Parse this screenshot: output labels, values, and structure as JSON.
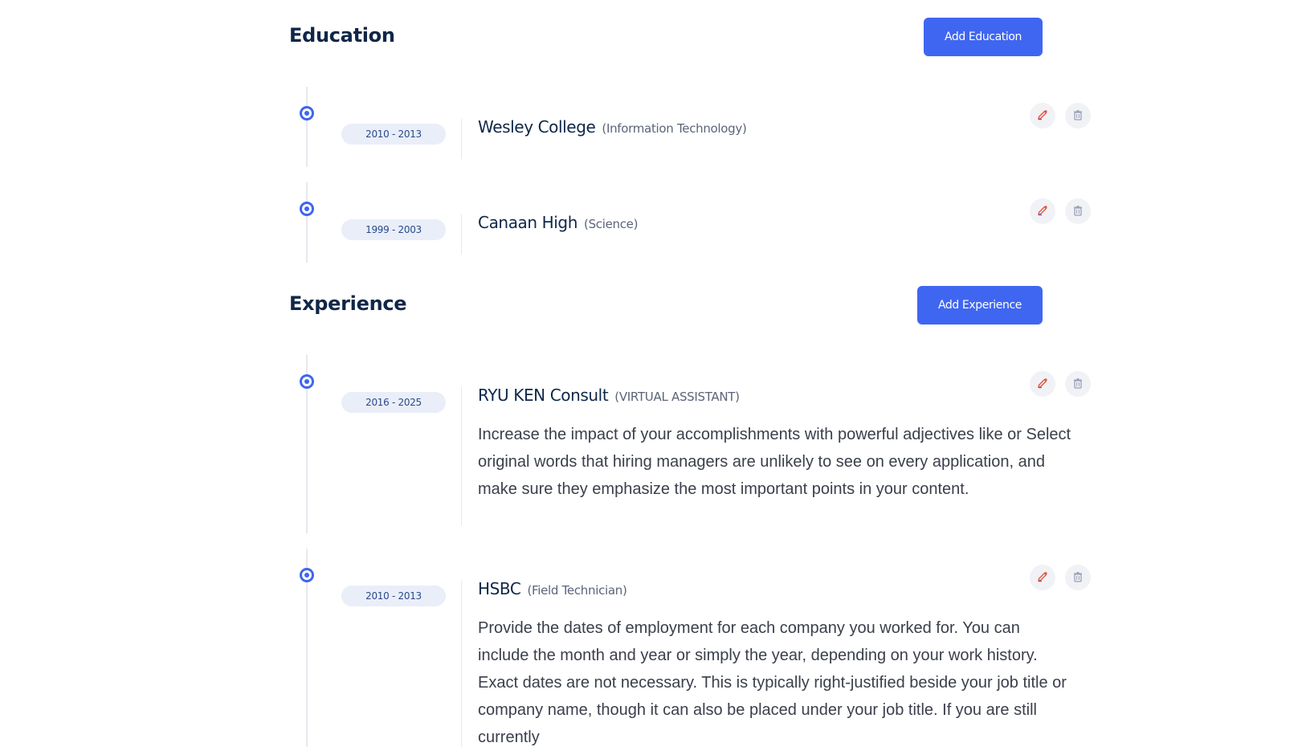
{
  "education": {
    "title": "Education",
    "add_label": "Add Education",
    "items": [
      {
        "dates": "2010 - 2013",
        "org": "Wesley College",
        "role": "(Information Technology)"
      },
      {
        "dates": "1999 - 2003",
        "org": "Canaan High",
        "role": "(Science)"
      }
    ]
  },
  "experience": {
    "title": "Experience",
    "add_label": "Add Experience",
    "items": [
      {
        "dates": "2016 - 2025",
        "org": "RYU KEN Consult",
        "role": "(VIRTUAL ASSISTANT)",
        "description": "Increase the impact of your accomplishments with powerful adjectives like or Select original words that hiring managers are unlikely to see on every application, and make sure they emphasize the most important points in your content."
      },
      {
        "dates": "2010 - 2013",
        "org": "HSBC",
        "role": "(Field Technician)",
        "description": "Provide the dates of employment for each company you worked for. You can include the month and year or simply the year, depending on your work history. Exact dates are not necessary. This is typically right-justified beside your job title or company name, though it can also be placed under your job title. If you are still currently"
      }
    ]
  },
  "icons": {
    "edit": "edit-icon",
    "delete": "trash-icon"
  },
  "colors": {
    "accent": "#3f66f0",
    "edit_icon": "#e4573c",
    "delete_icon": "#9aa0b5"
  }
}
